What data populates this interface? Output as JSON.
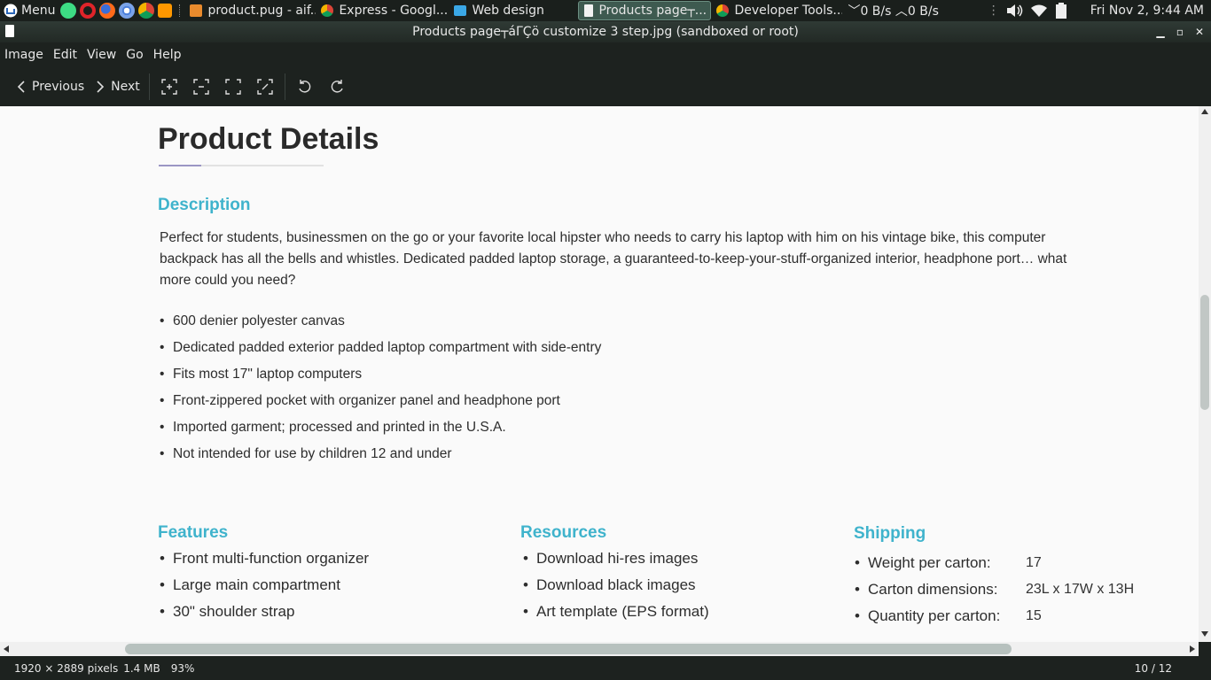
{
  "taskbar": {
    "menu_label": "Menu",
    "tasks": [
      {
        "label": "product.pug - aif...",
        "icon": "brackets-app-icon"
      },
      {
        "label": "Express - Googl...",
        "icon": "chrome-icon"
      },
      {
        "label": "Web design",
        "icon": "folder-icon"
      },
      {
        "label": "Products page┬...",
        "icon": "image-viewer-icon"
      },
      {
        "label": "Developer Tools...",
        "icon": "chrome-icon"
      }
    ],
    "net_down": "0 B/s",
    "net_up": "0 B/s",
    "clock": "Fri Nov  2,  9:44 AM",
    "colors": {
      "active_task": "#3e5a50"
    }
  },
  "window": {
    "title": "Products page┬áΓÇö customize 3 step.jpg (sandboxed or root)"
  },
  "menubar": {
    "items": [
      "Image",
      "Edit",
      "View",
      "Go",
      "Help"
    ]
  },
  "toolbar": {
    "previous_label": "Previous",
    "next_label": "Next"
  },
  "content": {
    "title": "Product Details",
    "description_heading": "Description",
    "description_text": "Perfect for students, businessmen on the go or your favorite local hipster who needs to carry his laptop with him on his vintage bike, this computer backpack has all the bells and whistles. Dedicated padded laptop storage, a guaranteed-to-keep-your-stuff-organized interior, headphone port… what more could you need?",
    "description_items": [
      "600 denier polyester canvas",
      "Dedicated padded exterior padded laptop compartment with side-entry",
      "Fits most 17\" laptop computers",
      "Front-zippered pocket with organizer panel and headphone port",
      "Imported garment; processed and printed in the U.S.A.",
      "Not intended for use by children 12 and under"
    ],
    "features": {
      "heading": "Features",
      "items": [
        "Front multi-function organizer",
        "Large main compartment",
        "30\" shoulder strap"
      ]
    },
    "resources": {
      "heading": "Resources",
      "items": [
        "Download hi-res images",
        "Download black images",
        "Art template (EPS format)"
      ]
    },
    "shipping": {
      "heading": "Shipping",
      "rows": [
        {
          "label": "Weight per carton:",
          "value": "17"
        },
        {
          "label": "Carton dimensions:",
          "value": "23L x 17W x 13H"
        },
        {
          "label": "Quantity per carton:",
          "value": "15"
        }
      ]
    },
    "colors": {
      "heading": "#3fb3cc",
      "title": "#2a2a2a",
      "underline_accent": "#9b96c4"
    }
  },
  "statusbar": {
    "dimensions": "1920 × 2889 pixels",
    "size": "1.4 MB",
    "zoom": "93%",
    "position": "10 / 12"
  }
}
